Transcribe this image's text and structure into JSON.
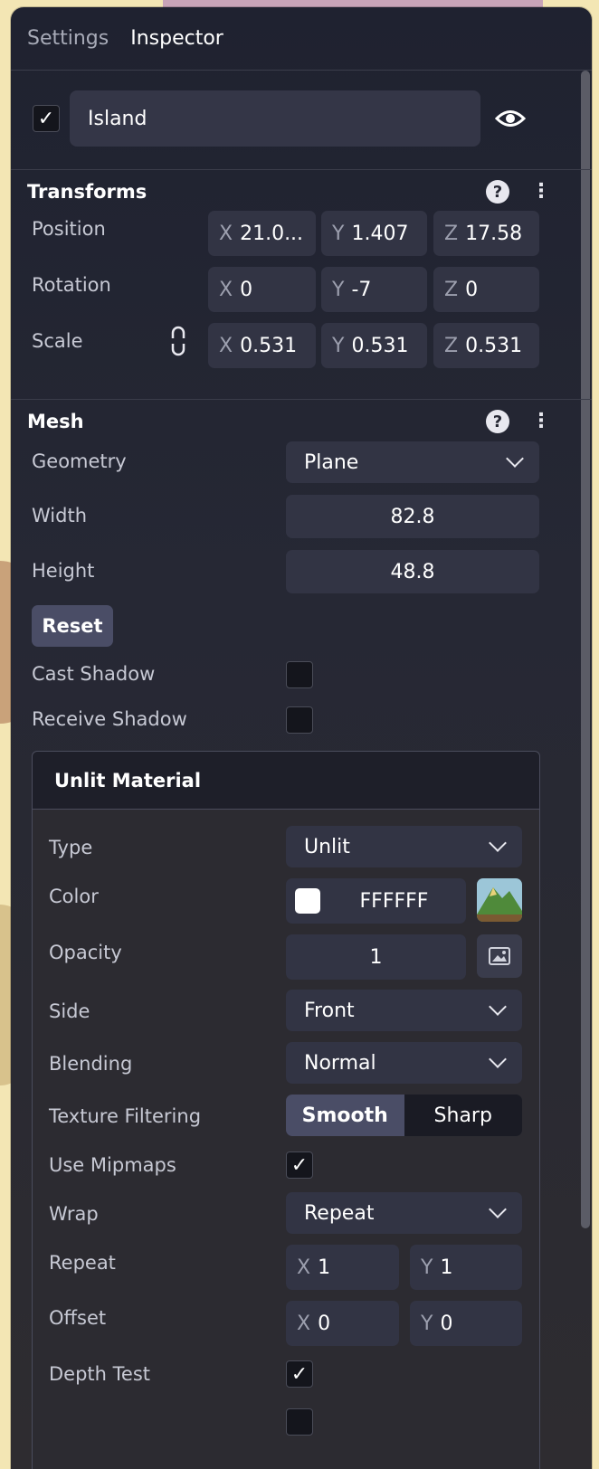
{
  "tabs": [
    "Settings",
    "Inspector"
  ],
  "object": {
    "name": "Island",
    "visible_icon": "eye-icon",
    "enabled": true
  },
  "transforms": {
    "title": "Transforms",
    "position": {
      "label": "Position",
      "x": "21.0...",
      "y": "1.407",
      "z": "17.58"
    },
    "rotation": {
      "label": "Rotation",
      "x": "0",
      "y": "-7",
      "z": "0"
    },
    "scale": {
      "label": "Scale",
      "x": "0.531",
      "y": "0.531",
      "z": "0.531"
    },
    "axes": {
      "x": "X",
      "y": "Y",
      "z": "Z"
    }
  },
  "mesh": {
    "title": "Mesh",
    "geometry_label": "Geometry",
    "geometry_value": "Plane",
    "width_label": "Width",
    "width_value": "82.8",
    "height_label": "Height",
    "height_value": "48.8",
    "reset_label": "Reset",
    "cast_shadow_label": "Cast Shadow",
    "cast_shadow": false,
    "receive_shadow_label": "Receive Shadow",
    "receive_shadow": false
  },
  "material": {
    "title": "Unlit Material",
    "type_label": "Type",
    "type_value": "Unlit",
    "color_label": "Color",
    "color_value": "FFFFFF",
    "opacity_label": "Opacity",
    "opacity_value": "1",
    "side_label": "Side",
    "side_value": "Front",
    "blending_label": "Blending",
    "blending_value": "Normal",
    "filter_label": "Texture Filtering",
    "filter_options": [
      "Smooth",
      "Sharp"
    ],
    "filter_selected": "Smooth",
    "mipmaps_label": "Use Mipmaps",
    "mipmaps": true,
    "wrap_label": "Wrap",
    "wrap_value": "Repeat",
    "repeat_label": "Repeat",
    "repeat_x": "1",
    "repeat_y": "1",
    "offset_label": "Offset",
    "offset_x": "0",
    "offset_y": "0",
    "depth_test_label": "Depth Test",
    "depth_test": true
  },
  "colors": {
    "panel_bg": "#262834",
    "field_bg": "#323444",
    "accent": "#4a4d66"
  }
}
